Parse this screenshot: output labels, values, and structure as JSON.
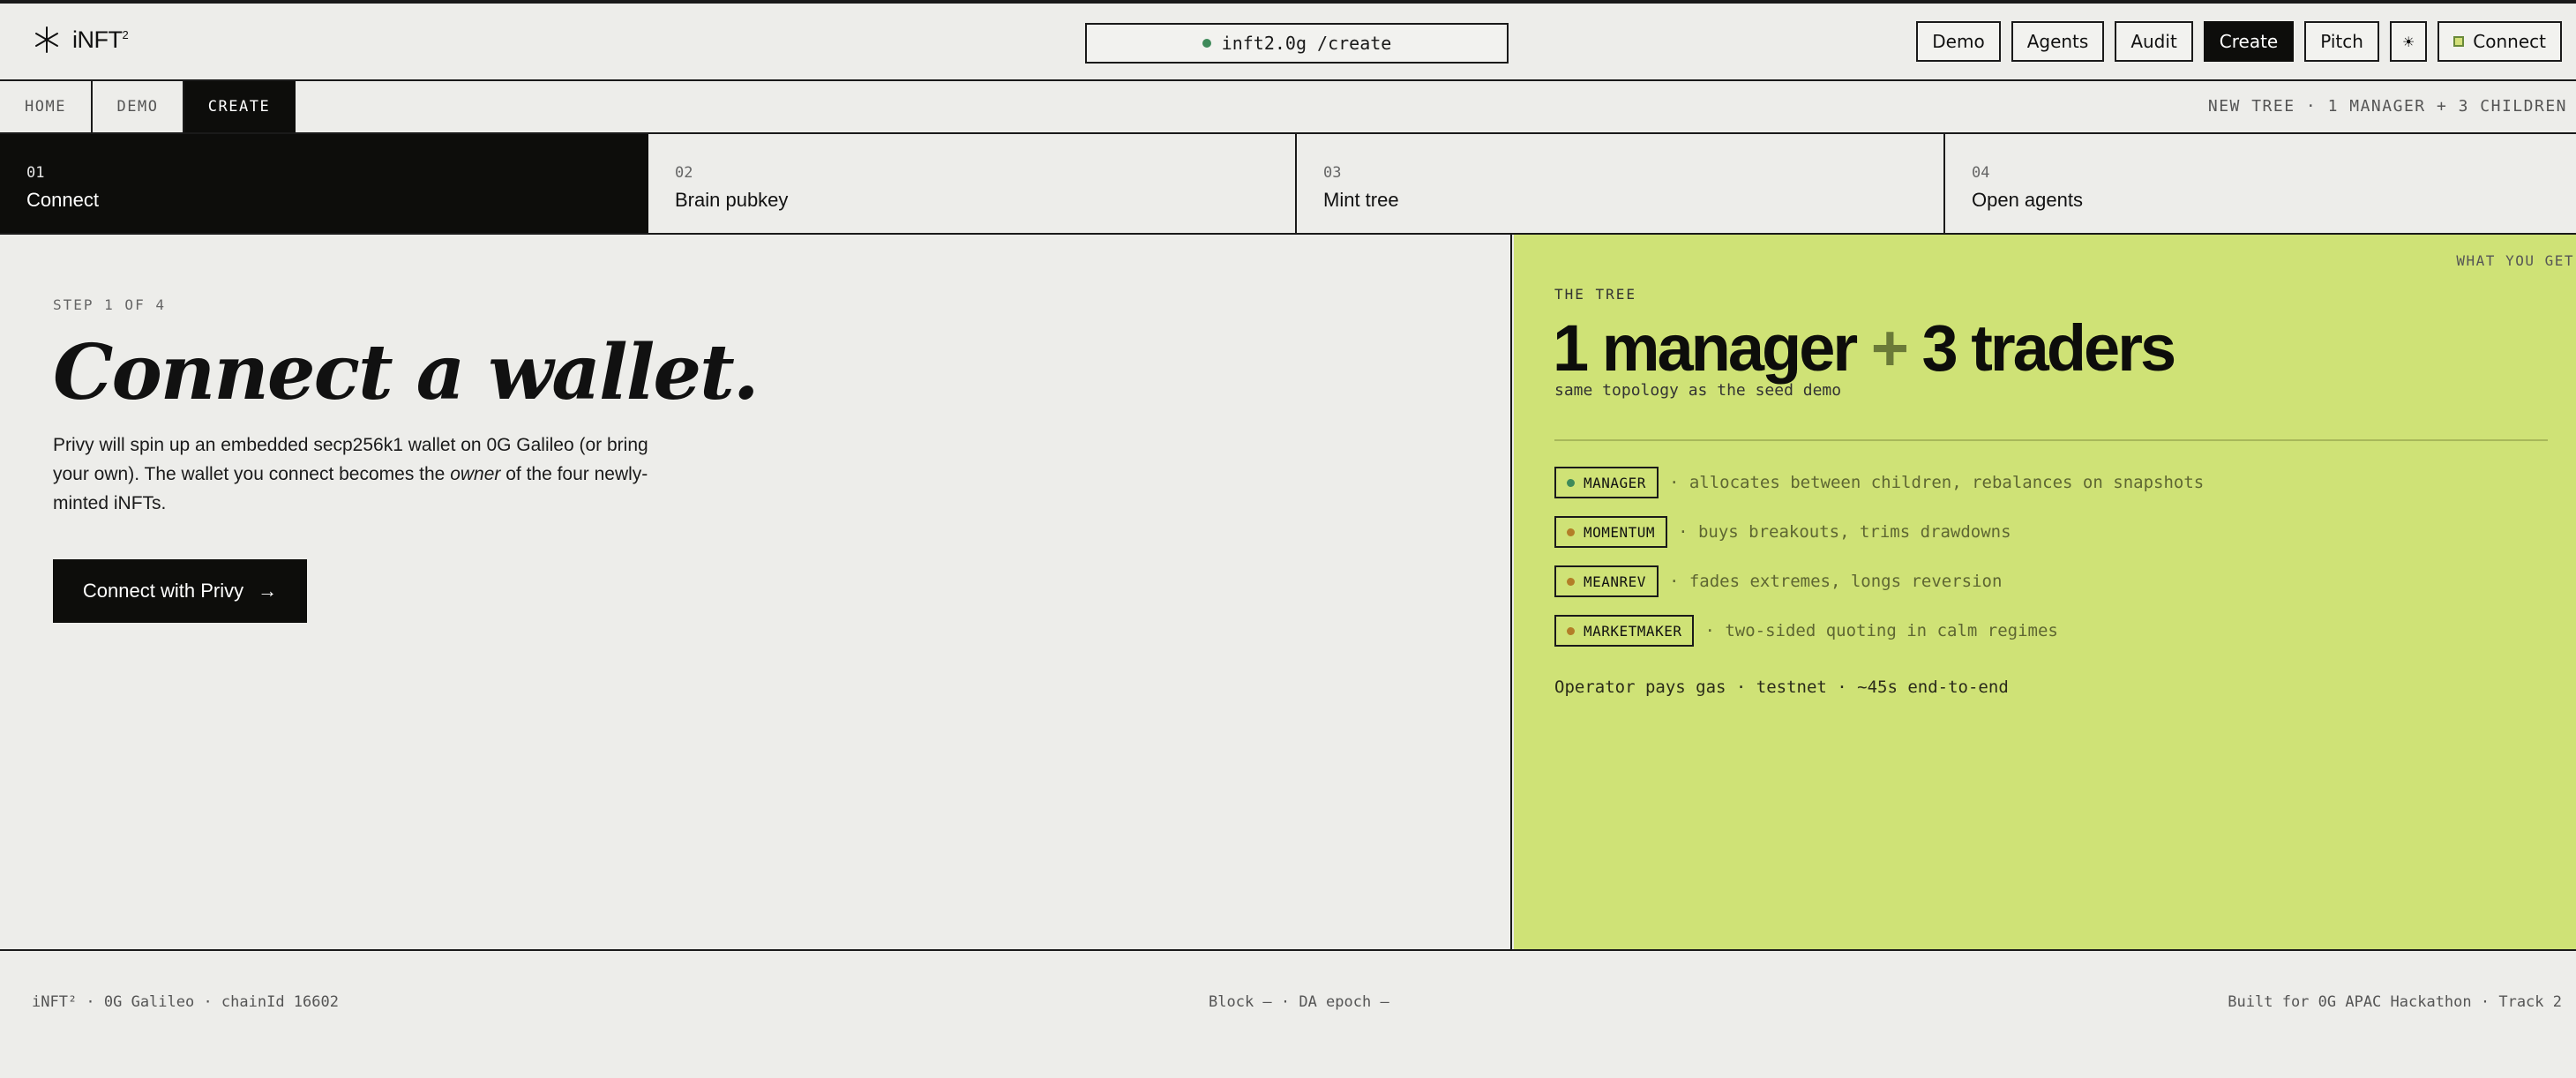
{
  "header": {
    "logo_text": "iNFT",
    "logo_superscript": "2",
    "url": "inft2.0g /create",
    "nav": [
      "Demo",
      "Agents",
      "Audit",
      "Create",
      "Pitch"
    ],
    "active_nav": "Create",
    "theme_icon": "☀",
    "connect_label": "Connect"
  },
  "tabs": {
    "items": [
      "HOME",
      "DEMO",
      "CREATE"
    ],
    "active": "CREATE",
    "note": "NEW TREE · 1 MANAGER + 3 CHILDREN"
  },
  "steps": [
    {
      "num": "01",
      "title": "Connect"
    },
    {
      "num": "02",
      "title": "Brain pubkey"
    },
    {
      "num": "03",
      "title": "Mint tree"
    },
    {
      "num": "04",
      "title": "Open agents"
    }
  ],
  "main": {
    "step_label": "STEP 1 OF 4",
    "title": "Connect a wallet.",
    "desc_before": "Privy will spin up an embedded secp256k1 wallet on 0G Galileo (or bring your own). The wallet you connect becomes the ",
    "desc_em": "owner",
    "desc_after": " of the four newly-minted iNFTs.",
    "cta_label": "Connect with Privy",
    "cta_arrow": "→"
  },
  "tree": {
    "corner_label": "WHAT YOU GET",
    "label": "THE TREE",
    "title_part1": "1 manager",
    "title_plus": "+",
    "title_part2": "3 traders",
    "subtitle": "same topology as the seed demo",
    "roles": [
      {
        "name": "MANAGER",
        "desc": "· allocates between children, rebalances on snapshots",
        "dot_color": "#3f8a5a"
      },
      {
        "name": "MOMENTUM",
        "desc": "· buys breakouts, trims drawdowns",
        "dot_color": "#b37e28"
      },
      {
        "name": "MEANREV",
        "desc": "· fades extremes, longs reversion",
        "dot_color": "#b37e28"
      },
      {
        "name": "MARKETMAKER",
        "desc": "· two-sided quoting in calm regimes",
        "dot_color": "#b37e28"
      }
    ],
    "operator_note": "Operator pays gas · testnet · ~45s end-to-end"
  },
  "footer": {
    "left": "iNFT² · 0G Galileo · chainId 16602",
    "center": "Block — · DA epoch —",
    "right": "Built for 0G APAC Hackathon · Track 2"
  },
  "colors": {
    "accent_panel": "#cfe276",
    "active": "#0d0d0b",
    "background": "#ededea"
  }
}
